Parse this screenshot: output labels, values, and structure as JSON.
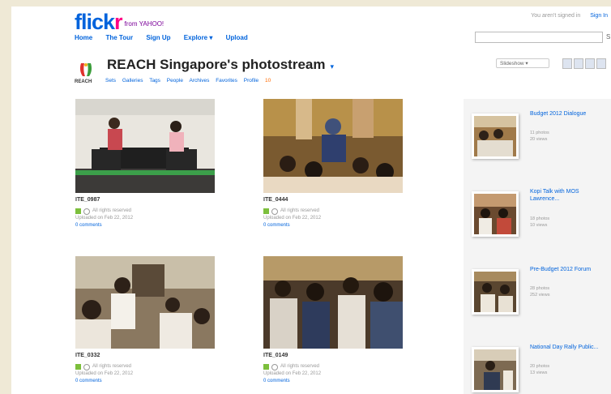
{
  "header": {
    "logo_main": "flick",
    "logo_accent": "r",
    "logo_tagline": "from YAHOO!",
    "top_text": "You aren't signed in",
    "signin": "Sign In"
  },
  "nav": [
    "Home",
    "The Tour",
    "Sign Up",
    "Explore ▾",
    "Upload"
  ],
  "search": {
    "button": "S"
  },
  "profile": {
    "title": "REACH Singapore's photostream",
    "more": "▾",
    "reach_label": "REACH",
    "subnav": [
      "Sets",
      "Galleries",
      "Tags",
      "People",
      "Archives",
      "Favorites",
      "Profile"
    ],
    "count": "10"
  },
  "controls": {
    "slideshow": "Slideshow ▾"
  },
  "photos": [
    {
      "name": "ITE_0987",
      "license": "All rights reserved",
      "uploaded": "Uploaded on Feb 22, 2012",
      "comments": "0 comments"
    },
    {
      "name": "ITE_0444",
      "license": "All rights reserved",
      "uploaded": "Uploaded on Feb 22, 2012",
      "comments": "0 comments"
    },
    {
      "name": "ITE_0332",
      "license": "All rights reserved",
      "uploaded": "Uploaded on Feb 22, 2012",
      "comments": "0 comments"
    },
    {
      "name": "ITE_0149",
      "license": "All rights reserved",
      "uploaded": "Uploaded on Feb 22, 2012",
      "comments": "0 comments"
    }
  ],
  "sets": [
    {
      "title": "Budget 2012 Dialogue",
      "photos": "11 photos",
      "views": "20 views"
    },
    {
      "title": "Kopi Talk with MOS Lawrence...",
      "photos": "18 photos",
      "views": "10 views"
    },
    {
      "title": "Pre-Budget 2012 Forum",
      "photos": "28 photos",
      "views": "252 views"
    },
    {
      "title": "National Day Rally Public...",
      "photos": "20 photos",
      "views": "13 views"
    }
  ],
  "colors": {
    "flickr_blue": "#0063dc",
    "flickr_pink": "#ff0084",
    "license_green": "#7cbf3c"
  }
}
